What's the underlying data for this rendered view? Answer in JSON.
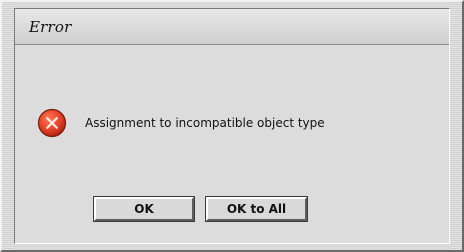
{
  "dialog": {
    "title": "Error",
    "message": "Assignment to incompatible object type",
    "icon": "error-x-icon",
    "colors": {
      "icon_fill": "#e8442a",
      "icon_border": "#8a1a0a",
      "background": "#dadada"
    }
  },
  "buttons": {
    "ok_label": "OK",
    "ok_all_label": "OK to All"
  }
}
